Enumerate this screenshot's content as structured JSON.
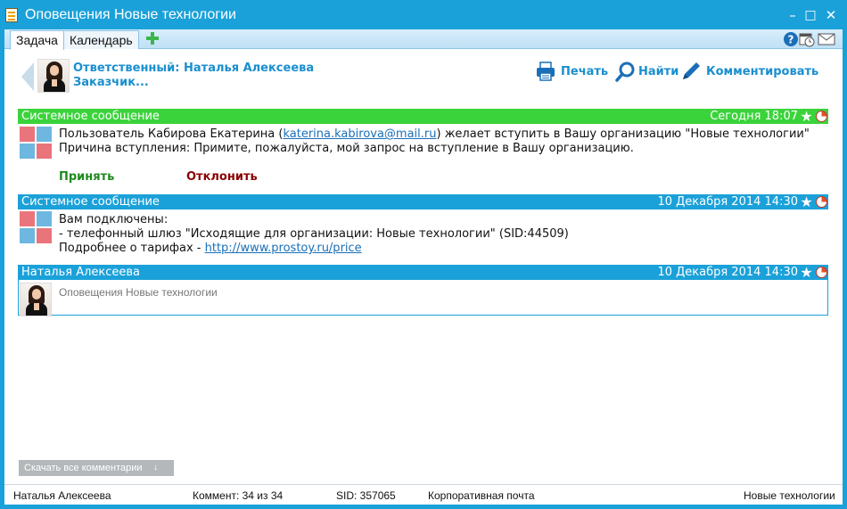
{
  "window": {
    "title": "Оповещения Новые технологии",
    "minimize": "–",
    "maximize": "□",
    "close": "✕"
  },
  "tabs": [
    {
      "label": "Задача",
      "active": true
    },
    {
      "label": "Календарь",
      "active": false
    }
  ],
  "header": {
    "responsible": "Ответственный: Наталья Алексеева",
    "client": "Заказчик...",
    "actions": {
      "print": "Печать",
      "find": "Найти",
      "comment": "Комментировать"
    }
  },
  "messages": [
    {
      "author": "Системное сообщение",
      "time": "Сегодня 18:07",
      "color": "#3bd33b",
      "line1_pre": "Пользователь Кабирова Екатерина (",
      "email": "katerina.kabirova@mail.ru",
      "line1_post": ") желает вступить в Вашу организацию \"Новые технологии\"",
      "line2": "Причина вступления: Примите, пожалуйста, мой запрос на вступление в Вашу организацию.",
      "accept": "Принять",
      "decline": "Отклонить"
    },
    {
      "author": "Системное сообщение",
      "time": "10 Декабря 2014 14:30",
      "color": "#1ba1d9",
      "line1": "Вам подключены:",
      "line2": "- телефонный шлюз \"Исходящие для организации: Новые технологии\" (SID:44509)",
      "line3_pre": "Подробнее о тарифах - ",
      "link": "http://www.prostoy.ru/price"
    },
    {
      "author": "Наталья Алексеева",
      "time": "10 Декабря 2014 14:30",
      "color": "#1ba1d9",
      "text": "Оповещения Новые технологии"
    }
  ],
  "download_all": "Скачать все комментарии",
  "status": {
    "user": "Наталья Алексеева",
    "comments": "Коммент: 34 из 34",
    "sid": "SID: 357065",
    "mail": "Корпоративная почта",
    "org": "Новые технологии"
  }
}
